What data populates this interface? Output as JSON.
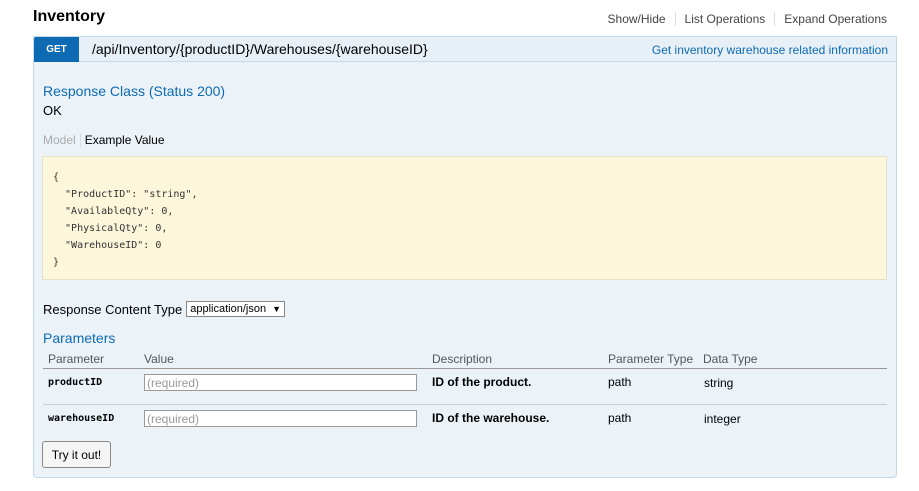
{
  "header": {
    "title": "Inventory",
    "links": [
      "Show/Hide",
      "List Operations",
      "Expand Operations"
    ]
  },
  "operation": {
    "verb": "GET",
    "path": "/api/Inventory/{productID}/Warehouses/{warehouseID}",
    "summary": "Get inventory warehouse related information"
  },
  "response": {
    "title": "Response Class (Status 200)",
    "status_text": "OK",
    "tab_model": "Model",
    "tab_example": "Example Value",
    "example_value": "{\n  \"ProductID\": \"string\",\n  \"AvailableQty\": 0,\n  \"PhysicalQty\": 0,\n  \"WarehouseID\": 0\n}",
    "content_type_label": "Response Content Type",
    "content_type_value": "application/json"
  },
  "parameters": {
    "title": "Parameters",
    "columns": {
      "parameter": "Parameter",
      "value": "Value",
      "description": "Description",
      "param_type": "Parameter Type",
      "data_type": "Data Type"
    },
    "rows": [
      {
        "name": "productID",
        "placeholder": "(required)",
        "description": "ID of the product.",
        "param_type": "path",
        "data_type": "string"
      },
      {
        "name": "warehouseID",
        "placeholder": "(required)",
        "description": "ID of the warehouse.",
        "param_type": "path",
        "data_type": "integer"
      }
    ]
  },
  "try_button": "Try it out!",
  "colors": {
    "accent": "#0f6ab4",
    "panel_bg": "#ebf3f9",
    "example_bg": "#fcf6db"
  }
}
